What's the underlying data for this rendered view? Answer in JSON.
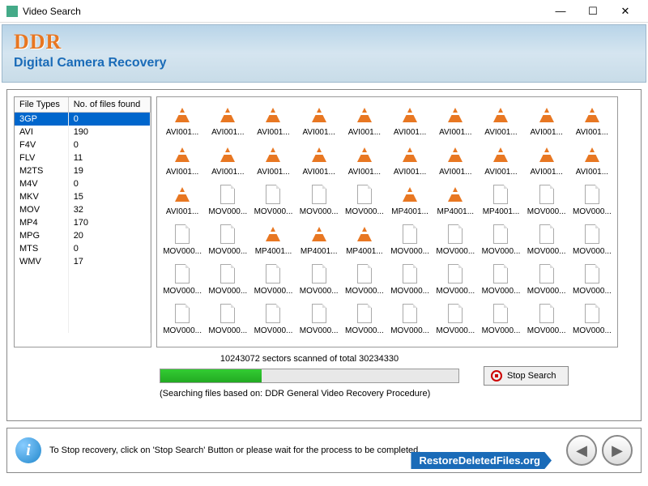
{
  "window": {
    "title": "Video Search",
    "minimize": "—",
    "maximize": "☐",
    "close": "✕"
  },
  "banner": {
    "logo": "DDR",
    "subtitle": "Digital Camera Recovery"
  },
  "table": {
    "col1": "File Types",
    "col2": "No. of files found",
    "rows": [
      {
        "type": "3GP",
        "count": "0",
        "selected": true
      },
      {
        "type": "AVI",
        "count": "190"
      },
      {
        "type": "F4V",
        "count": "0"
      },
      {
        "type": "FLV",
        "count": "11"
      },
      {
        "type": "M2TS",
        "count": "19"
      },
      {
        "type": "M4V",
        "count": "0"
      },
      {
        "type": "MKV",
        "count": "15"
      },
      {
        "type": "MOV",
        "count": "32"
      },
      {
        "type": "MP4",
        "count": "170"
      },
      {
        "type": "MPG",
        "count": "20"
      },
      {
        "type": "MTS",
        "count": "0"
      },
      {
        "type": "WMV",
        "count": "17"
      }
    ]
  },
  "files": [
    {
      "n": "AVI001...",
      "i": "v"
    },
    {
      "n": "AVI001...",
      "i": "v"
    },
    {
      "n": "AVI001...",
      "i": "v"
    },
    {
      "n": "AVI001...",
      "i": "v"
    },
    {
      "n": "AVI001...",
      "i": "v"
    },
    {
      "n": "AVI001...",
      "i": "v"
    },
    {
      "n": "AVI001...",
      "i": "v"
    },
    {
      "n": "AVI001...",
      "i": "v"
    },
    {
      "n": "AVI001...",
      "i": "v"
    },
    {
      "n": "AVI001...",
      "i": "v"
    },
    {
      "n": "AVI001...",
      "i": "v"
    },
    {
      "n": "AVI001...",
      "i": "v"
    },
    {
      "n": "AVI001...",
      "i": "v"
    },
    {
      "n": "AVI001...",
      "i": "v"
    },
    {
      "n": "AVI001...",
      "i": "v"
    },
    {
      "n": "AVI001...",
      "i": "v"
    },
    {
      "n": "AVI001...",
      "i": "v"
    },
    {
      "n": "AVI001...",
      "i": "v"
    },
    {
      "n": "AVI001...",
      "i": "v"
    },
    {
      "n": "AVI001...",
      "i": "v"
    },
    {
      "n": "AVI001...",
      "i": "v"
    },
    {
      "n": "MOV000...",
      "i": "d"
    },
    {
      "n": "MOV000...",
      "i": "d"
    },
    {
      "n": "MOV000...",
      "i": "d"
    },
    {
      "n": "MOV000...",
      "i": "d"
    },
    {
      "n": "MP4001...",
      "i": "v"
    },
    {
      "n": "MP4001...",
      "i": "v"
    },
    {
      "n": "MP4001...",
      "i": "d"
    },
    {
      "n": "MOV000...",
      "i": "d"
    },
    {
      "n": "MOV000...",
      "i": "d"
    },
    {
      "n": "MOV000...",
      "i": "d"
    },
    {
      "n": "MOV000...",
      "i": "d"
    },
    {
      "n": "MP4001...",
      "i": "v"
    },
    {
      "n": "MP4001...",
      "i": "v"
    },
    {
      "n": "MP4001...",
      "i": "v"
    },
    {
      "n": "MOV000...",
      "i": "d"
    },
    {
      "n": "MOV000...",
      "i": "d"
    },
    {
      "n": "MOV000...",
      "i": "d"
    },
    {
      "n": "MOV000...",
      "i": "d"
    },
    {
      "n": "MOV000...",
      "i": "d"
    },
    {
      "n": "MOV000...",
      "i": "d"
    },
    {
      "n": "MOV000...",
      "i": "d"
    },
    {
      "n": "MOV000...",
      "i": "d"
    },
    {
      "n": "MOV000...",
      "i": "d"
    },
    {
      "n": "MOV000...",
      "i": "d"
    },
    {
      "n": "MOV000...",
      "i": "d"
    },
    {
      "n": "MOV000...",
      "i": "d"
    },
    {
      "n": "MOV000...",
      "i": "d"
    },
    {
      "n": "MOV000...",
      "i": "d"
    },
    {
      "n": "MOV000...",
      "i": "d"
    },
    {
      "n": "MOV000...",
      "i": "d"
    },
    {
      "n": "MOV000...",
      "i": "d"
    },
    {
      "n": "MOV000...",
      "i": "d"
    },
    {
      "n": "MOV000...",
      "i": "d"
    },
    {
      "n": "MOV000...",
      "i": "d"
    },
    {
      "n": "MOV000...",
      "i": "d"
    },
    {
      "n": "MOV000...",
      "i": "d"
    },
    {
      "n": "MOV000...",
      "i": "d"
    },
    {
      "n": "MOV000...",
      "i": "d"
    },
    {
      "n": "MOV000...",
      "i": "d"
    }
  ],
  "progress": {
    "label": "10243072 sectors scanned of total 30234330",
    "note": "(Searching files based on:  DDR General Video Recovery Procedure)",
    "stop": "Stop Search"
  },
  "footer": {
    "text": "To Stop recovery, click on 'Stop Search' Button or please wait for the process to be completed.",
    "website": "RestoreDeletedFiles.org",
    "prev": "◀",
    "next": "▶"
  }
}
